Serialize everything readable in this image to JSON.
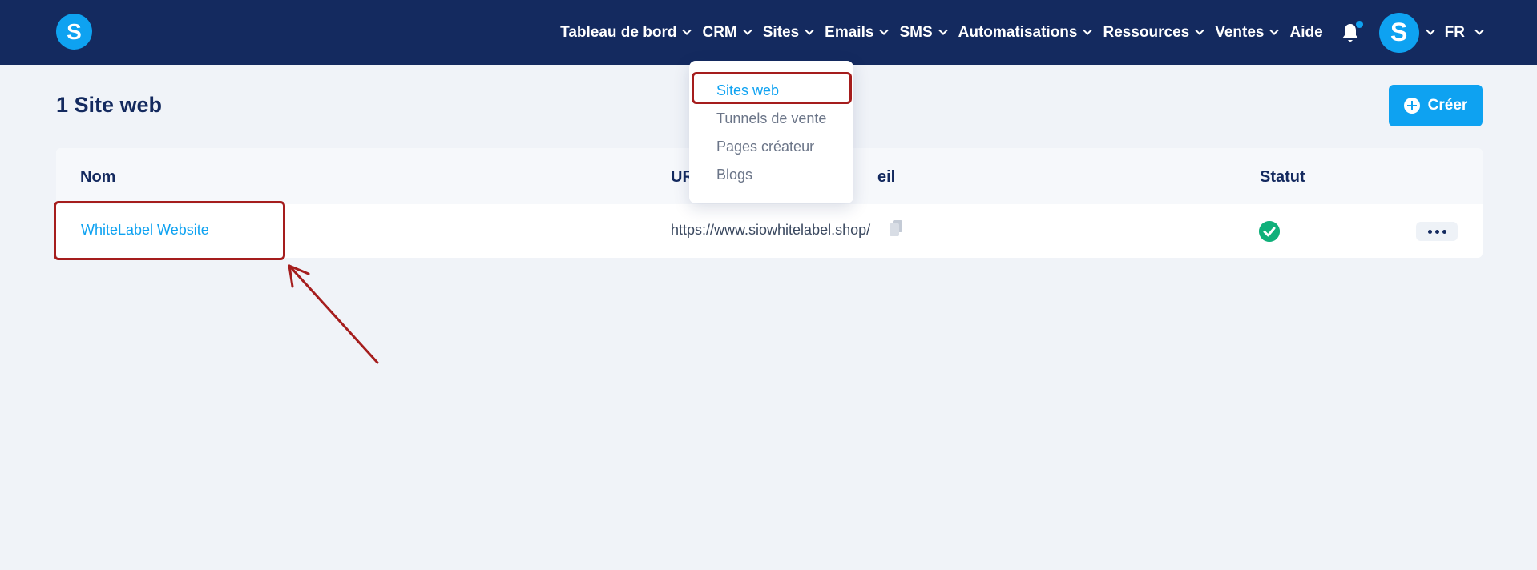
{
  "brand": {
    "logo_letter": "S"
  },
  "nav": {
    "items": [
      {
        "label": "Tableau de bord",
        "has_dropdown": true
      },
      {
        "label": "CRM",
        "has_dropdown": true
      },
      {
        "label": "Sites",
        "has_dropdown": true
      },
      {
        "label": "Emails",
        "has_dropdown": true
      },
      {
        "label": "SMS",
        "has_dropdown": true
      },
      {
        "label": "Automatisations",
        "has_dropdown": true
      },
      {
        "label": "Ressources",
        "has_dropdown": true
      },
      {
        "label": "Ventes",
        "has_dropdown": true
      },
      {
        "label": "Aide",
        "has_dropdown": false
      }
    ],
    "avatar_letter": "S",
    "language": "FR"
  },
  "page": {
    "title": "1 Site web",
    "create_label": "Créer"
  },
  "table": {
    "headers": {
      "name": "Nom",
      "url_prefix": "UR",
      "url_suffix": "eil",
      "status": "Statut"
    },
    "rows": [
      {
        "name": "WhiteLabel Website",
        "url": "https://www.siowhitelabel.shop/",
        "status": "active"
      }
    ]
  },
  "sites_menu": {
    "items": [
      {
        "label": "Sites web",
        "active": true
      },
      {
        "label": "Tunnels de vente",
        "active": false
      },
      {
        "label": "Pages créateur",
        "active": false
      },
      {
        "label": "Blogs",
        "active": false
      }
    ]
  },
  "colors": {
    "navbar": "#142a5f",
    "accent": "#0ea2f1",
    "highlight": "#a51d1d",
    "status_ok": "#10b07a",
    "background": "#f0f3f8"
  },
  "icons": [
    "bell-icon",
    "copy-icon",
    "check-circle-icon",
    "plus-circle-icon",
    "more-dots-icon",
    "chevron-down-icon"
  ]
}
